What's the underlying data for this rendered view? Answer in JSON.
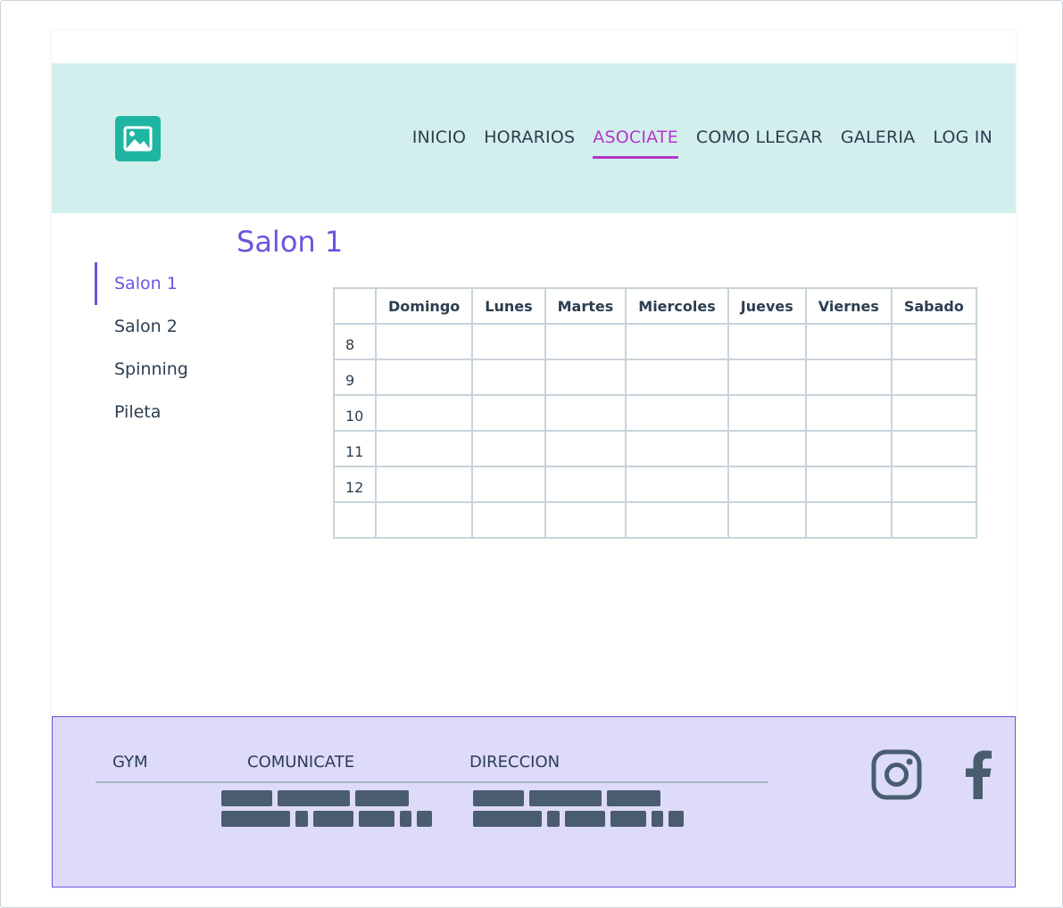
{
  "nav": {
    "items": [
      {
        "label": "INICIO",
        "active": false
      },
      {
        "label": "HORARIOS",
        "active": false
      },
      {
        "label": "ASOCIATE",
        "active": true
      },
      {
        "label": "COMO LLEGAR",
        "active": false
      },
      {
        "label": "GALERIA",
        "active": false
      },
      {
        "label": "LOG IN",
        "active": false
      }
    ]
  },
  "logo_icon": "image-icon",
  "page_title": "Salon 1",
  "sidebar": {
    "items": [
      {
        "label": "Salon 1",
        "active": true
      },
      {
        "label": "Salon 2",
        "active": false
      },
      {
        "label": "Spinning",
        "active": false
      },
      {
        "label": "Pileta",
        "active": false
      }
    ]
  },
  "schedule": {
    "columns": [
      "",
      "Domingo",
      "Lunes",
      "Martes",
      "Miercoles",
      "Jueves",
      "Viernes",
      "Sabado"
    ],
    "rows": [
      "8",
      "9",
      "10",
      "11",
      "12",
      ""
    ]
  },
  "footer": {
    "col1": "GYM",
    "col2": "COMUNICATE",
    "col3": "DIRECCION",
    "social_icons": [
      "instagram-icon",
      "facebook-icon"
    ]
  },
  "colors": {
    "header_bg": "#d2efed",
    "accent_nav": "#b536c9",
    "accent_primary": "#6a55e0",
    "footer_bg": "#dedbfa",
    "logo": "#1fb5a3"
  }
}
